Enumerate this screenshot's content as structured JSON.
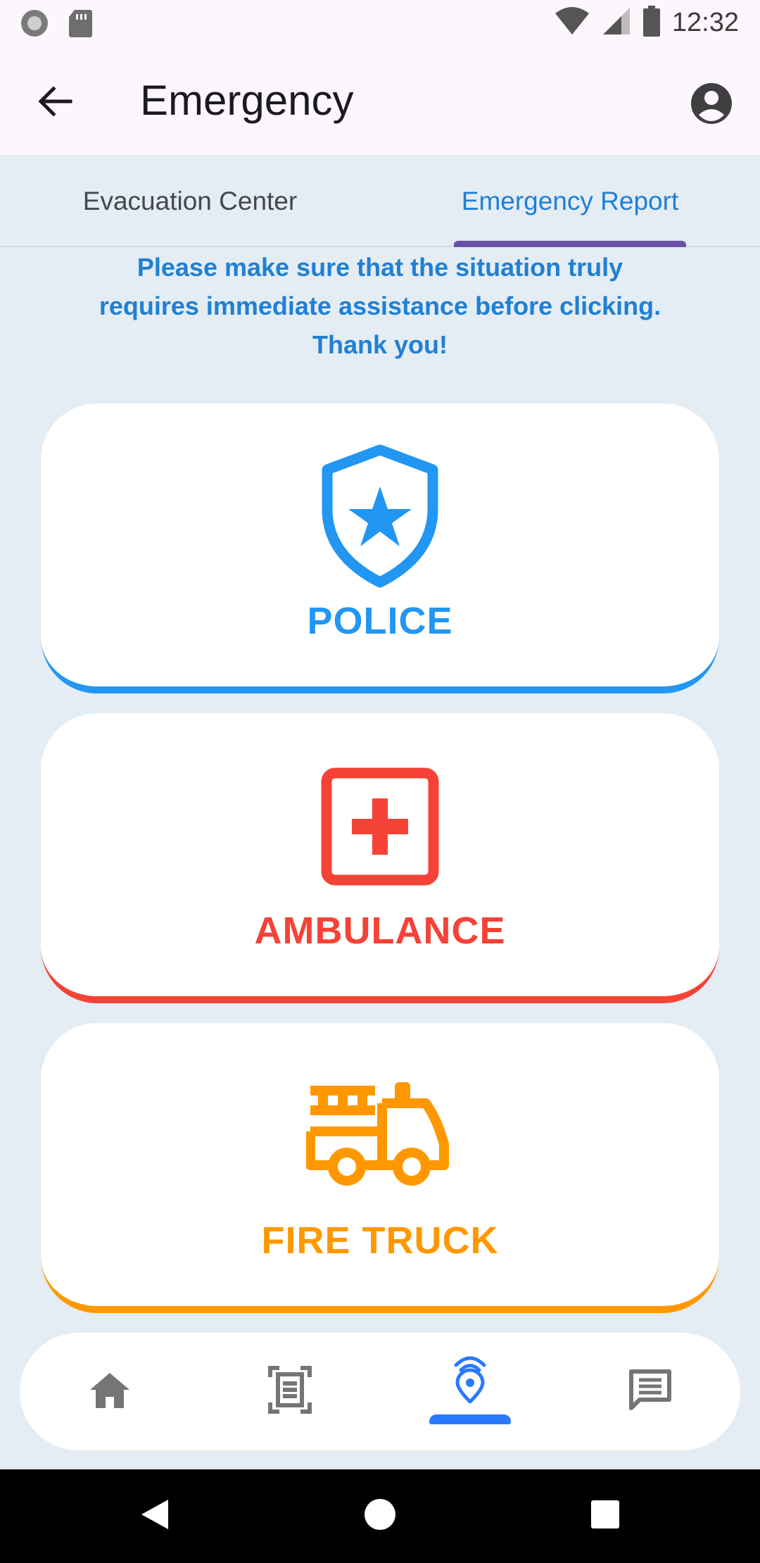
{
  "status_bar": {
    "time": "12:32",
    "icons": [
      "record-icon",
      "sd-card-icon",
      "wifi-icon",
      "signal-icon",
      "battery-icon"
    ]
  },
  "app_bar": {
    "title": "Emergency",
    "back_icon": "arrow-back-icon",
    "account_icon": "account-circle-icon"
  },
  "tabs": [
    {
      "label": "Evacuation Center",
      "active": false
    },
    {
      "label": "Emergency Report",
      "active": true
    }
  ],
  "notice": {
    "line1": "Please make sure that the situation truly",
    "line2": "requires immediate assistance before clicking.",
    "line3": "Thank you!"
  },
  "cards": [
    {
      "label": "POLICE",
      "icon": "police-shield-icon",
      "color": "#2196f3"
    },
    {
      "label": "AMBULANCE",
      "icon": "medical-cross-icon",
      "color": "#f44336"
    },
    {
      "label": "FIRE TRUCK",
      "icon": "fire-truck-icon",
      "color": "#ff9800"
    }
  ],
  "bottom_nav": {
    "items": [
      {
        "icon": "home-icon",
        "active": false
      },
      {
        "icon": "document-scan-icon",
        "active": false
      },
      {
        "icon": "location-broadcast-icon",
        "active": true
      },
      {
        "icon": "chat-icon",
        "active": false
      }
    ],
    "accent": "#2979ff"
  },
  "colors": {
    "background": "#e4ecf4",
    "app_bar": "#fdf7fd",
    "primary_text": "#1f80d4",
    "tab_indicator": "#6a50a8"
  }
}
